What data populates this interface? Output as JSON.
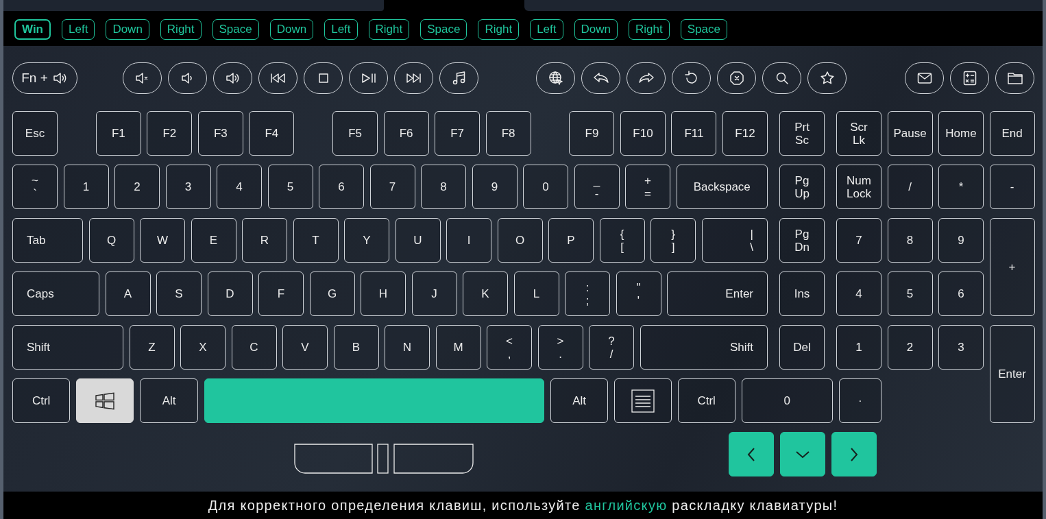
{
  "history": [
    {
      "label": "Win",
      "selected": true
    },
    {
      "label": "Left",
      "selected": false
    },
    {
      "label": "Down",
      "selected": false
    },
    {
      "label": "Right",
      "selected": false
    },
    {
      "label": "Space",
      "selected": false
    },
    {
      "label": "Down",
      "selected": false
    },
    {
      "label": "Left",
      "selected": false
    },
    {
      "label": "Right",
      "selected": false
    },
    {
      "label": "Space",
      "selected": false
    },
    {
      "label": "Right",
      "selected": false
    },
    {
      "label": "Left",
      "selected": false
    },
    {
      "label": "Down",
      "selected": false
    },
    {
      "label": "Right",
      "selected": false
    },
    {
      "label": "Space",
      "selected": false
    }
  ],
  "media_groups": [
    [
      {
        "kind": "fn-volume",
        "label": "Fn +"
      }
    ],
    [
      {
        "kind": "mute"
      },
      {
        "kind": "volume-down"
      },
      {
        "kind": "volume-up"
      },
      {
        "kind": "previous"
      },
      {
        "kind": "stop"
      },
      {
        "kind": "play-pause"
      },
      {
        "kind": "next"
      },
      {
        "kind": "music"
      }
    ],
    [
      {
        "kind": "browser"
      },
      {
        "kind": "back"
      },
      {
        "kind": "forward"
      },
      {
        "kind": "refresh"
      },
      {
        "kind": "browser-stop"
      },
      {
        "kind": "search"
      },
      {
        "kind": "favorites"
      }
    ],
    [
      {
        "kind": "mail"
      },
      {
        "kind": "calculator"
      },
      {
        "kind": "files"
      }
    ]
  ],
  "main_rows": [
    {
      "groups": [
        [
          {
            "label": "Esc",
            "pressed": false,
            "current": false
          }
        ],
        [
          {
            "label": "F1",
            "pressed": false,
            "current": false
          },
          {
            "label": "F2",
            "pressed": false,
            "current": false
          },
          {
            "label": "F3",
            "pressed": false,
            "current": false
          },
          {
            "label": "F4",
            "pressed": false,
            "current": false
          }
        ],
        [
          {
            "label": "F5",
            "pressed": false,
            "current": false
          },
          {
            "label": "F6",
            "pressed": false,
            "current": false
          },
          {
            "label": "F7",
            "pressed": false,
            "current": false
          },
          {
            "label": "F8",
            "pressed": false,
            "current": false
          }
        ],
        [
          {
            "label": "F9",
            "pressed": false,
            "current": false
          },
          {
            "label": "F10",
            "pressed": false,
            "current": false
          },
          {
            "label": "F11",
            "pressed": false,
            "current": false
          },
          {
            "label": "F12",
            "pressed": false,
            "current": false
          }
        ]
      ]
    },
    {
      "groups": [
        [
          {
            "lines": [
              "~",
              "`"
            ],
            "pressed": false,
            "current": false
          },
          {
            "label": "1",
            "pressed": false,
            "current": false
          },
          {
            "label": "2",
            "pressed": false,
            "current": false
          },
          {
            "label": "3",
            "pressed": false,
            "current": false
          },
          {
            "label": "4",
            "pressed": false,
            "current": false
          },
          {
            "label": "5",
            "pressed": false,
            "current": false
          },
          {
            "label": "6",
            "pressed": false,
            "current": false
          },
          {
            "label": "7",
            "pressed": false,
            "current": false
          },
          {
            "label": "8",
            "pressed": false,
            "current": false
          },
          {
            "label": "9",
            "pressed": false,
            "current": false
          },
          {
            "label": "0",
            "pressed": false,
            "current": false
          },
          {
            "lines": [
              "_",
              "-"
            ],
            "pressed": false,
            "current": false
          },
          {
            "lines": [
              "+",
              "="
            ],
            "pressed": false,
            "current": false
          },
          {
            "label": "Backspace",
            "pressed": false,
            "current": false
          }
        ]
      ]
    },
    {
      "groups": [
        [
          {
            "label": "Tab",
            "pressed": false,
            "current": false
          },
          {
            "label": "Q",
            "pressed": false,
            "current": false
          },
          {
            "label": "W",
            "pressed": false,
            "current": false
          },
          {
            "label": "E",
            "pressed": false,
            "current": false
          },
          {
            "label": "R",
            "pressed": false,
            "current": false
          },
          {
            "label": "T",
            "pressed": false,
            "current": false
          },
          {
            "label": "Y",
            "pressed": false,
            "current": false
          },
          {
            "label": "U",
            "pressed": false,
            "current": false
          },
          {
            "label": "I",
            "pressed": false,
            "current": false
          },
          {
            "label": "O",
            "pressed": false,
            "current": false
          },
          {
            "label": "P",
            "pressed": false,
            "current": false
          },
          {
            "lines": [
              "{",
              "["
            ],
            "pressed": false,
            "current": false
          },
          {
            "lines": [
              "}",
              "]"
            ],
            "pressed": false,
            "current": false
          },
          {
            "lines": [
              "|",
              "\\"
            ],
            "pressed": false,
            "current": false
          }
        ]
      ]
    },
    {
      "groups": [
        [
          {
            "label": "Caps",
            "pressed": false,
            "current": false
          },
          {
            "label": "A",
            "pressed": false,
            "current": false
          },
          {
            "label": "S",
            "pressed": false,
            "current": false
          },
          {
            "label": "D",
            "pressed": false,
            "current": false
          },
          {
            "label": "F",
            "pressed": false,
            "current": false
          },
          {
            "label": "G",
            "pressed": false,
            "current": false
          },
          {
            "label": "H",
            "pressed": false,
            "current": false
          },
          {
            "label": "J",
            "pressed": false,
            "current": false
          },
          {
            "label": "K",
            "pressed": false,
            "current": false
          },
          {
            "label": "L",
            "pressed": false,
            "current": false
          },
          {
            "lines": [
              ":",
              ";"
            ],
            "pressed": false,
            "current": false
          },
          {
            "lines": [
              "\"",
              "'"
            ],
            "pressed": false,
            "current": false
          },
          {
            "label": "Enter",
            "pressed": false,
            "current": false
          }
        ]
      ]
    },
    {
      "groups": [
        [
          {
            "label": "Shift",
            "pressed": false,
            "current": false
          },
          {
            "label": "Z",
            "pressed": false,
            "current": false
          },
          {
            "label": "X",
            "pressed": false,
            "current": false
          },
          {
            "label": "C",
            "pressed": false,
            "current": false
          },
          {
            "label": "V",
            "pressed": false,
            "current": false
          },
          {
            "label": "B",
            "pressed": false,
            "current": false
          },
          {
            "label": "N",
            "pressed": false,
            "current": false
          },
          {
            "label": "M",
            "pressed": false,
            "current": false
          },
          {
            "lines": [
              "<",
              ","
            ],
            "pressed": false,
            "current": false
          },
          {
            "lines": [
              ">",
              "."
            ],
            "pressed": false,
            "current": false
          },
          {
            "lines": [
              "?",
              "/"
            ],
            "pressed": false,
            "current": false
          },
          {
            "label": "Shift",
            "pressed": false,
            "current": false
          }
        ]
      ]
    }
  ],
  "nav_keys": [
    {
      "lines": [
        "Prt",
        "Sc"
      ],
      "pressed": false,
      "current": false
    },
    {
      "lines": [
        "Pg",
        "Up"
      ],
      "pressed": false,
      "current": false
    },
    {
      "lines": [
        "Pg",
        "Dn"
      ],
      "pressed": false,
      "current": false
    },
    {
      "label": "Ins",
      "pressed": false,
      "current": false
    },
    {
      "label": "Del",
      "pressed": false,
      "current": false
    }
  ],
  "numpad_keys": [
    {
      "lines": [
        "Scr",
        "Lk"
      ],
      "pressed": false,
      "current": false
    },
    {
      "label": "Pause",
      "pressed": false,
      "current": false
    },
    {
      "label": "Home",
      "pressed": false,
      "current": false
    },
    {
      "label": "End",
      "pressed": false,
      "current": false
    },
    {
      "lines": [
        "Num",
        "Lock"
      ],
      "pressed": false,
      "current": false
    },
    {
      "label": "/",
      "pressed": false,
      "current": false
    },
    {
      "label": "*",
      "pressed": false,
      "current": false
    },
    {
      "label": "-",
      "pressed": false,
      "current": false
    },
    {
      "label": "7",
      "pressed": false,
      "current": false
    },
    {
      "label": "8",
      "pressed": false,
      "current": false
    },
    {
      "label": "9",
      "pressed": false,
      "current": false
    },
    {
      "label": "+",
      "kind": "tall",
      "pressed": false,
      "current": false
    },
    {
      "label": "4",
      "pressed": false,
      "current": false
    },
    {
      "label": "5",
      "pressed": false,
      "current": false
    },
    {
      "label": "6",
      "pressed": false,
      "current": false
    },
    {
      "label": "1",
      "pressed": false,
      "current": false
    },
    {
      "label": "2",
      "pressed": false,
      "current": false
    },
    {
      "label": "3",
      "pressed": false,
      "current": false
    },
    {
      "label": "Enter",
      "kind": "tall",
      "pressed": false,
      "current": false
    }
  ],
  "bottom_row": [
    {
      "label": "Ctrl",
      "pressed": false,
      "current": false
    },
    {
      "kind": "win",
      "pressed": false,
      "current": true
    },
    {
      "label": "Alt",
      "pressed": false,
      "current": false
    },
    {
      "kind": "space",
      "pressed": true,
      "current": false
    },
    {
      "label": "Alt",
      "pressed": false,
      "current": false
    },
    {
      "kind": "menu",
      "pressed": false,
      "current": false
    },
    {
      "label": "Ctrl",
      "pressed": false,
      "current": false
    },
    {
      "label": "0",
      "pressed": false,
      "current": false
    },
    {
      "label": "·",
      "pressed": false,
      "current": false
    }
  ],
  "arrow_keys": [
    {
      "kind": "left",
      "pressed": true,
      "current": false
    },
    {
      "kind": "down",
      "pressed": true,
      "current": false
    },
    {
      "kind": "right",
      "pressed": true,
      "current": false
    }
  ],
  "notice": [
    {
      "text": "Для корректного определения клавиш, используйте ",
      "highlight": false
    },
    {
      "text": "английскую",
      "highlight": true
    },
    {
      "text": " раскладку клавиатуры!",
      "highlight": false
    }
  ]
}
